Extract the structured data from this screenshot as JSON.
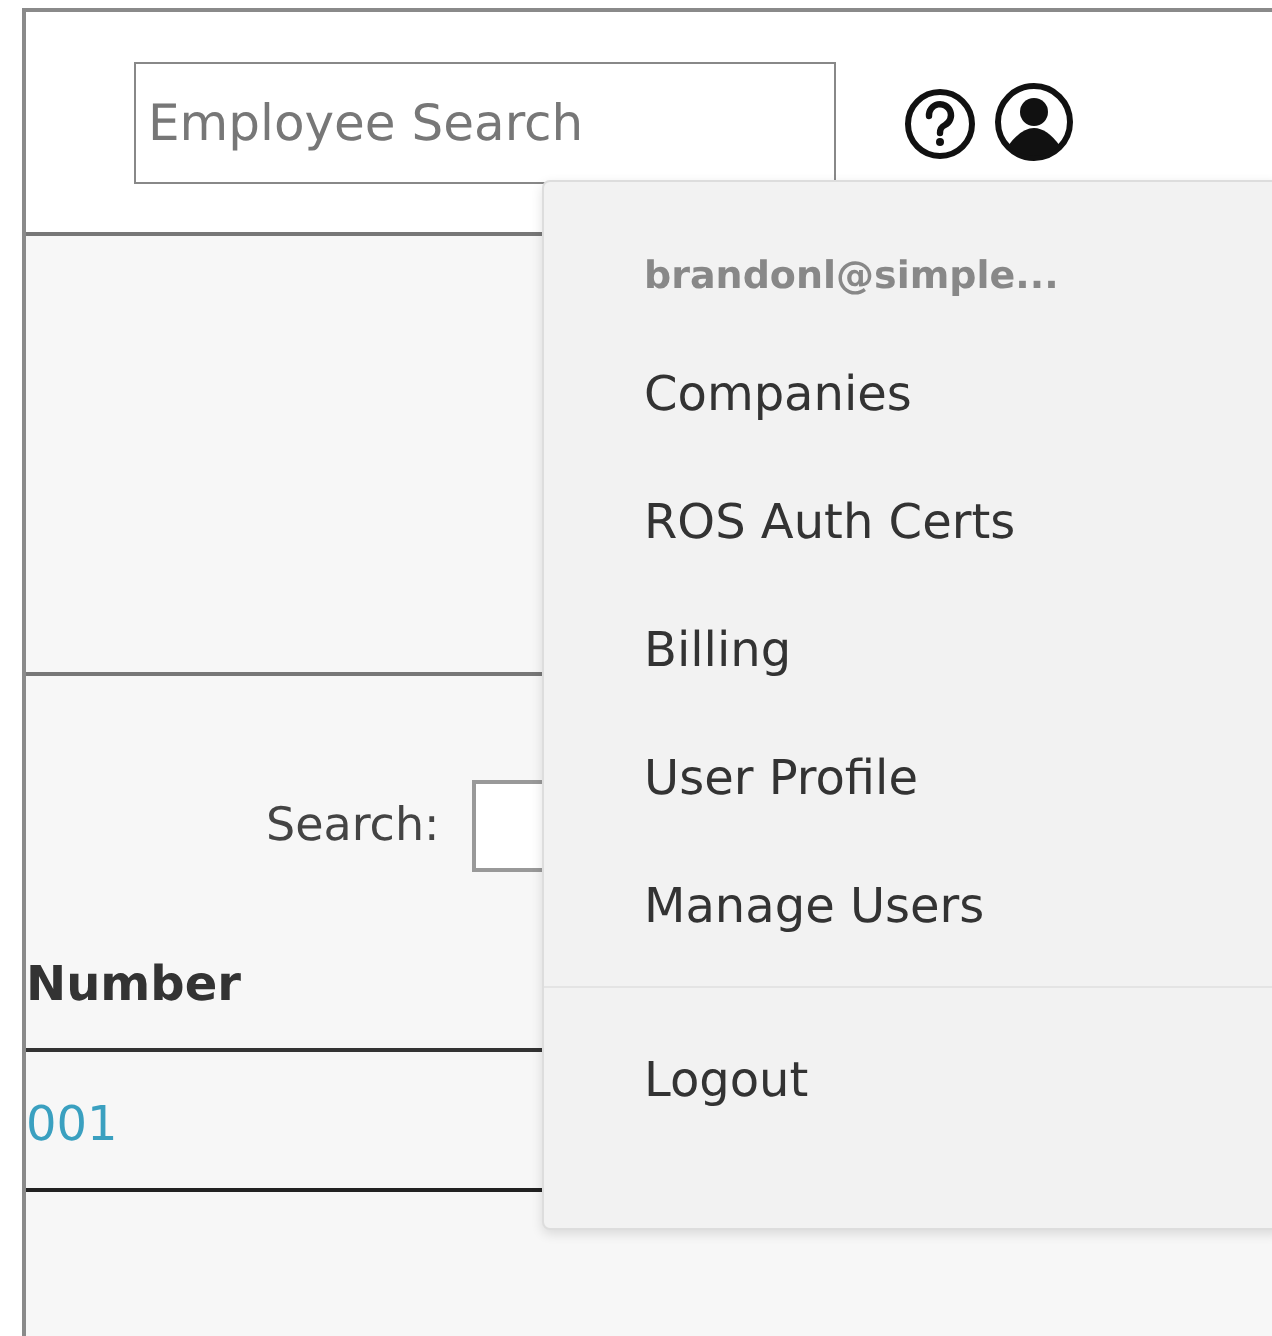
{
  "header": {
    "search": {
      "placeholder": "Employee Search"
    }
  },
  "user_menu": {
    "email": "brandonl@simple...",
    "items": [
      "Companies",
      "ROS Auth Certs",
      "Billing",
      "User Profile",
      "Manage Users"
    ],
    "logout": "Logout"
  },
  "table_search": {
    "label": "Search:"
  },
  "table": {
    "columns": [
      "Number"
    ],
    "rows": [
      [
        "001"
      ]
    ]
  }
}
